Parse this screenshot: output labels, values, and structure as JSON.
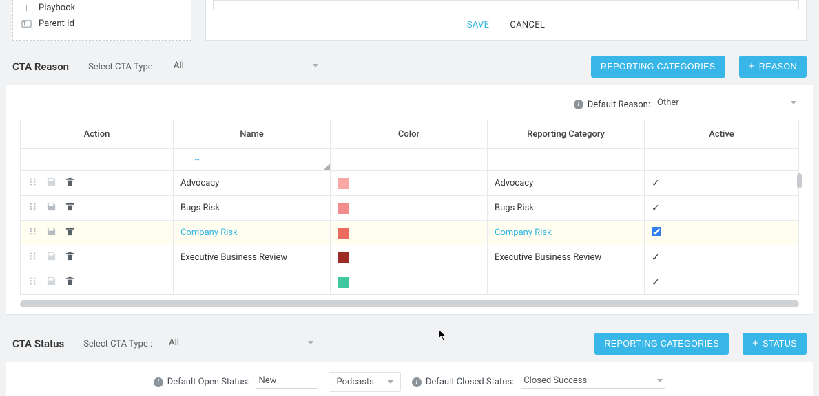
{
  "top_fields": [
    {
      "icon": "plus",
      "label": "Playbook"
    },
    {
      "icon": "text",
      "label": "Parent Id"
    }
  ],
  "editor": {
    "save": "SAVE",
    "cancel": "CANCEL"
  },
  "reason": {
    "title": "CTA Reason",
    "filter_label": "Select CTA Type :",
    "filter_value": "All",
    "btn_categories": "REPORTING CATEGORIES",
    "btn_add": "REASON",
    "default_label": "Default Reason:",
    "default_value": "Other",
    "columns": [
      "Action",
      "Name",
      "Color",
      "Reporting Category",
      "Active"
    ],
    "filter_hint": "~",
    "rows": [
      {
        "name": "Advocacy",
        "color": "#f8a6a6",
        "category": "Advocacy",
        "active": true,
        "editing": false,
        "save_disabled": true
      },
      {
        "name": "Bugs Risk",
        "color": "#f28b8b",
        "category": "Bugs Risk",
        "active": true,
        "editing": false,
        "save_disabled": false
      },
      {
        "name": "Company Risk",
        "color": "#ec6a5e",
        "category": "Company Risk",
        "active": true,
        "editing": true,
        "save_disabled": false
      },
      {
        "name": "Executive Business Review",
        "color": "#9e2b26",
        "category": "Executive Business Review",
        "active": true,
        "editing": false,
        "save_disabled": true
      },
      {
        "name": "",
        "color": "#3fc7a0",
        "category": "",
        "active": true,
        "editing": false,
        "save_disabled": true,
        "partial": true
      }
    ]
  },
  "status": {
    "title": "CTA Status",
    "filter_label": "Select CTA Type :",
    "filter_value": "All",
    "btn_categories": "REPORTING CATEGORIES",
    "btn_add": "STATUS",
    "open_label": "Default Open Status:",
    "open_value": "New",
    "chip": "Podcasts",
    "closed_label": "Default Closed Status:",
    "closed_value": "Closed Success"
  }
}
